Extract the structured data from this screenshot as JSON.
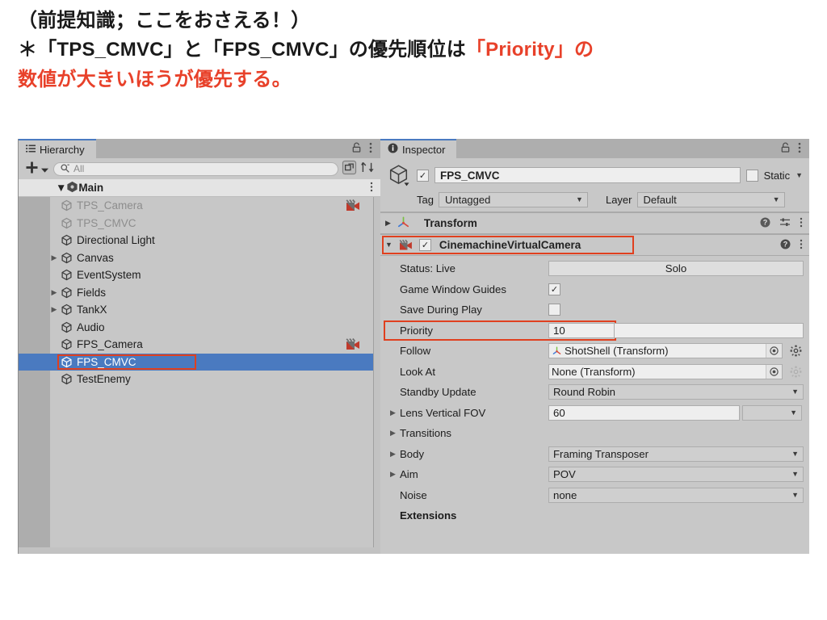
{
  "headline": {
    "line1": "（前提知識；ここをおさえる！）",
    "line2a": "＊「TPS_CMVC」と「FPS_CMVC」の優先順位は",
    "line2b": "「Priority」",
    "line2c": "の",
    "line3": "数値が大きいほうが優先する。"
  },
  "hierarchy": {
    "tab_label": "Hierarchy",
    "toolbar": {
      "add_label": "+",
      "search_placeholder": "All"
    },
    "scene_name": "Main",
    "items": [
      {
        "label": "TPS_Camera",
        "indent": 1,
        "ghost": true,
        "foldout": "",
        "selected": false,
        "cm_icon": true,
        "highlight": false
      },
      {
        "label": "TPS_CMVC",
        "indent": 1,
        "ghost": true,
        "foldout": "",
        "selected": false,
        "cm_icon": false,
        "highlight": false
      },
      {
        "label": "Directional Light",
        "indent": 1,
        "ghost": false,
        "foldout": "",
        "selected": false,
        "cm_icon": false,
        "highlight": false
      },
      {
        "label": "Canvas",
        "indent": 1,
        "ghost": false,
        "foldout": "▶",
        "selected": false,
        "cm_icon": false,
        "highlight": false
      },
      {
        "label": "EventSystem",
        "indent": 1,
        "ghost": false,
        "foldout": "",
        "selected": false,
        "cm_icon": false,
        "highlight": false
      },
      {
        "label": "Fields",
        "indent": 1,
        "ghost": false,
        "foldout": "▶",
        "selected": false,
        "cm_icon": false,
        "highlight": false
      },
      {
        "label": "TankX",
        "indent": 1,
        "ghost": false,
        "foldout": "▶",
        "selected": false,
        "cm_icon": false,
        "highlight": false
      },
      {
        "label": "Audio",
        "indent": 1,
        "ghost": false,
        "foldout": "",
        "selected": false,
        "cm_icon": false,
        "highlight": false
      },
      {
        "label": "FPS_Camera",
        "indent": 1,
        "ghost": false,
        "foldout": "",
        "selected": false,
        "cm_icon": true,
        "highlight": false
      },
      {
        "label": "FPS_CMVC",
        "indent": 1,
        "ghost": false,
        "foldout": "",
        "selected": true,
        "cm_icon": false,
        "highlight": true
      },
      {
        "label": "TestEnemy",
        "indent": 1,
        "ghost": false,
        "foldout": "",
        "selected": false,
        "cm_icon": false,
        "highlight": false
      }
    ]
  },
  "inspector": {
    "tab_label": "Inspector",
    "object_name": "FPS_CMVC",
    "object_enabled": true,
    "static_label": "Static",
    "static_checked": false,
    "tag_label": "Tag",
    "tag_value": "Untagged",
    "layer_label": "Layer",
    "layer_value": "Default",
    "components": [
      {
        "name": "Transform",
        "expanded": false,
        "has_checkbox": false,
        "highlight": false
      },
      {
        "name": "CinemachineVirtualCamera",
        "expanded": true,
        "has_checkbox": true,
        "checked": true,
        "highlight": true
      }
    ],
    "properties": [
      {
        "label": "Status: Live",
        "foldout": "",
        "type": "button",
        "value": "Solo",
        "highlight": false
      },
      {
        "label": "Game Window Guides",
        "foldout": "",
        "type": "checkbox",
        "value": true,
        "highlight": false
      },
      {
        "label": "Save During Play",
        "foldout": "",
        "type": "checkbox",
        "value": false,
        "highlight": false
      },
      {
        "label": "Priority",
        "foldout": "",
        "type": "text",
        "value": "10",
        "highlight": true
      },
      {
        "label": "Follow",
        "foldout": "",
        "type": "object",
        "value": "ShotShell (Transform)",
        "icon": "transform-axis-icon",
        "gear": true,
        "highlight": false
      },
      {
        "label": "Look At",
        "foldout": "",
        "type": "object",
        "value": "None (Transform)",
        "icon": "",
        "gear": true,
        "gear_dim": true,
        "highlight": false
      },
      {
        "label": "Standby Update",
        "foldout": "",
        "type": "popup",
        "value": "Round Robin",
        "highlight": false
      },
      {
        "label": "Lens Vertical FOV",
        "foldout": "▶",
        "type": "text-popup",
        "value": "60",
        "highlight": false
      },
      {
        "label": "Transitions",
        "foldout": "▶",
        "type": "none",
        "value": "",
        "highlight": false
      },
      {
        "label": "Body",
        "foldout": "▶",
        "type": "popup",
        "value": "Framing Transposer",
        "highlight": false
      },
      {
        "label": "Aim",
        "foldout": "▶",
        "type": "popup",
        "value": "POV",
        "highlight": false
      },
      {
        "label": "Noise",
        "foldout": "",
        "type": "popup",
        "value": "none",
        "highlight": false
      },
      {
        "label": "Extensions",
        "foldout": "",
        "type": "none",
        "value": "",
        "highlight": false
      }
    ]
  },
  "colors": {
    "accent_red": "#E8412A",
    "selection_blue": "#4A7AC0",
    "panel_gray": "#C8C8C8"
  }
}
